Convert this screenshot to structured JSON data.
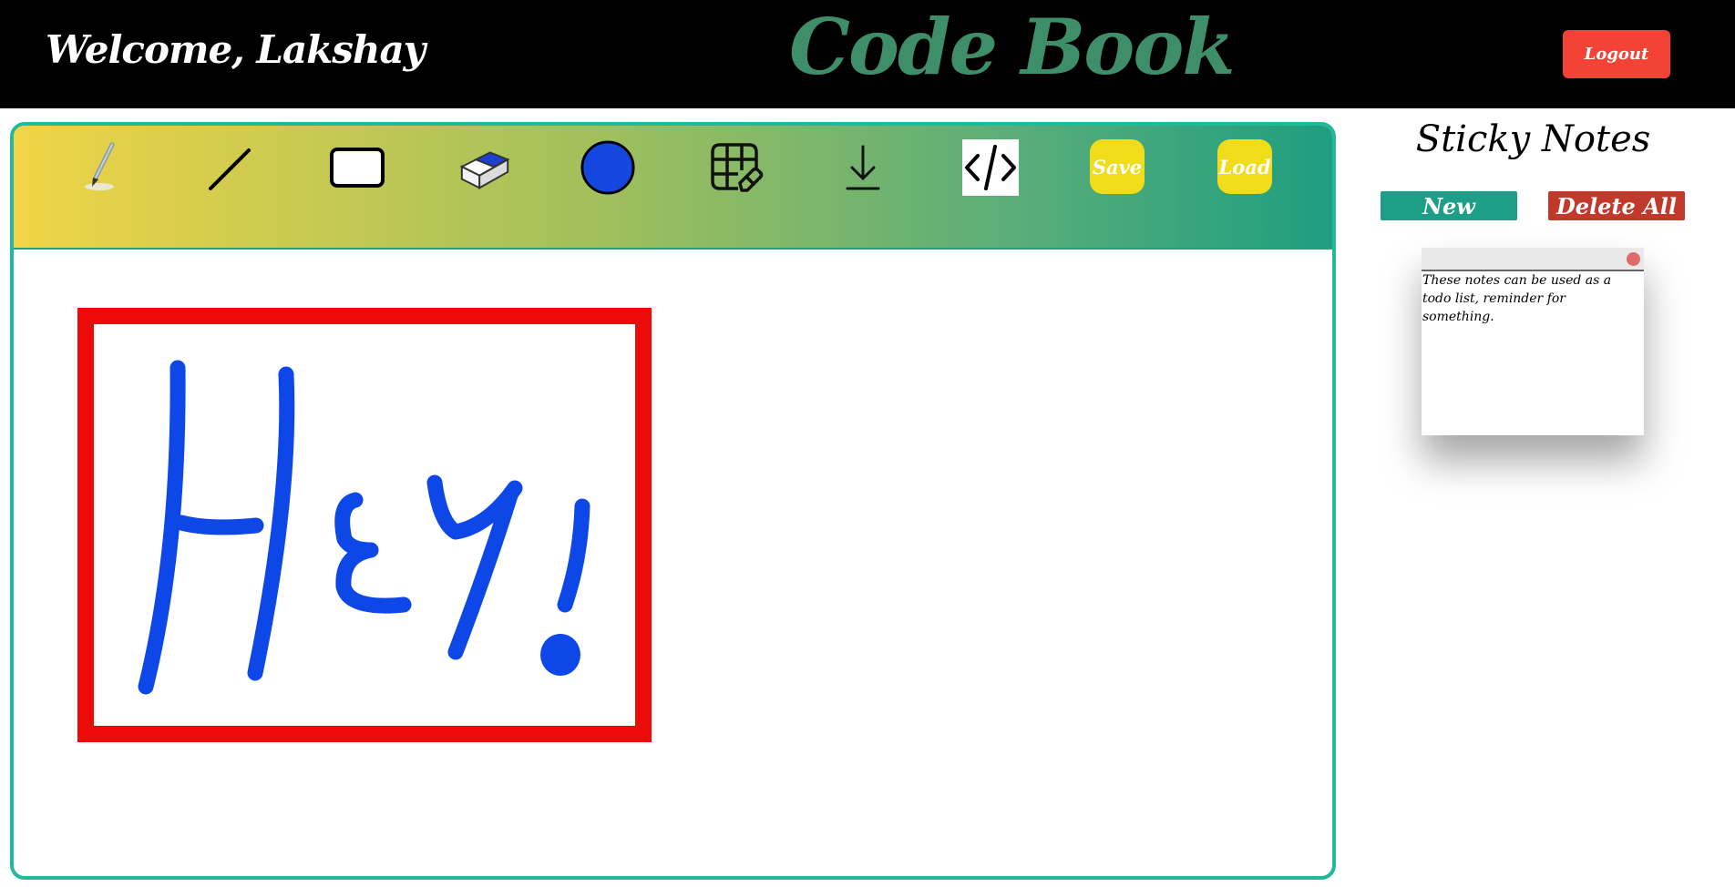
{
  "header": {
    "welcome": "Welcome, Lakshay",
    "brand": "Code Book",
    "logout_label": "Logout"
  },
  "toolbar": {
    "tools": [
      {
        "icon": "pencil-icon",
        "name": "pencil"
      },
      {
        "icon": "line-icon",
        "name": "line"
      },
      {
        "icon": "rectangle-icon",
        "name": "rectangle"
      },
      {
        "icon": "eraser-icon",
        "name": "eraser"
      },
      {
        "icon": "color-circle-icon",
        "name": "color",
        "value": "#1447e0"
      },
      {
        "icon": "clear-grid-icon",
        "name": "clear"
      },
      {
        "icon": "download-icon",
        "name": "download"
      },
      {
        "icon": "code-icon",
        "name": "code"
      }
    ],
    "save_label": "Save",
    "load_label": "Load"
  },
  "canvas": {
    "stroke_color": "#0d47e8",
    "rect_color": "#ef0a0a"
  },
  "sidebar": {
    "title": "Sticky Notes",
    "new_label": "New",
    "delete_all_label": "Delete All",
    "notes": [
      {
        "text": "These notes can be used as a todo list, reminder for something."
      }
    ]
  },
  "colors": {
    "accent": "#22b89a",
    "logout": "#f44336",
    "new_button": "#1d9e86",
    "delete_button": "#c0392b",
    "pill": "#f0dc1a"
  }
}
